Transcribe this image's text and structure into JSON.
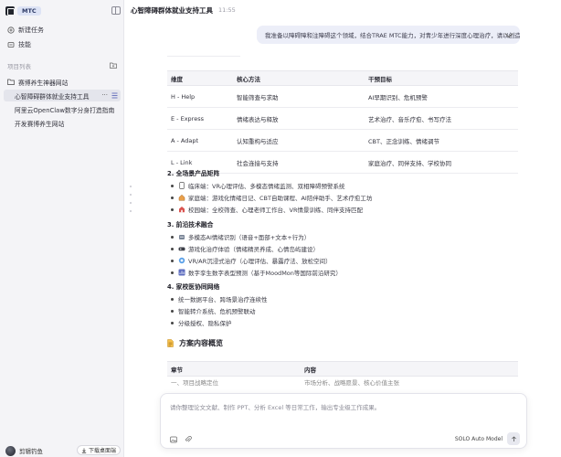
{
  "app": {
    "chip_label": "MTC"
  },
  "sidebar": {
    "nav": [
      {
        "label": "新建任务",
        "icon": "new-task-icon"
      },
      {
        "label": "技能",
        "icon": "skills-icon"
      }
    ],
    "section_label": "项目列表",
    "projects": [
      {
        "label": "赛博养生神器网站",
        "level": 0,
        "active": false
      },
      {
        "label": "心智障碍群体就业支持工具",
        "level": 1,
        "active": true
      },
      {
        "label": "阿里云OpenClaw数字分身打造指南",
        "level": 1,
        "active": false
      },
      {
        "label": "开发赛博养生网站",
        "level": 1,
        "active": false
      }
    ],
    "more_label": "···",
    "user_name": "剪辑钓鱼",
    "download_label": "下载桌面端"
  },
  "header": {
    "title": "心智障碍群体就业支持工具",
    "time": "11:55"
  },
  "user_message": "我准备以障碍障和注障碍这个领域，结合TRAE MTC能力，对青少年进行深度心理治疗，请以创造入",
  "methods_table": {
    "headers": [
      "维度",
      "核心方法",
      "干预目标"
    ],
    "rows": [
      [
        "H - Help",
        "智能筛查与求助",
        "AI早期识别、危机预警"
      ],
      [
        "E - Express",
        "情绪表达与释放",
        "艺术治疗、音乐疗愈、书写疗法"
      ],
      [
        "A - Adapt",
        "认知重构与适应",
        "CBT、正念训练、情绪调节"
      ],
      [
        "L - Link",
        "社会连接与支持",
        "家庭治疗、同伴支持、学校协同"
      ]
    ]
  },
  "section2": {
    "title": "2. 全场景产品矩阵",
    "items": [
      {
        "icon": "phone-icon",
        "text": "临床端：VR心理评估、多模态情绪监测、双相障碍预警系统"
      },
      {
        "icon": "home-icon",
        "text": "家庭端：游戏化情绪日记、CBT自助课程、AI陪伴助手、艺术疗愈工坊"
      },
      {
        "icon": "school-icon",
        "text": "校园端：全校筛查、心理老师工作台、VR情景训练、同伴支持匹配"
      }
    ]
  },
  "section3": {
    "title": "3. 前沿技术融合",
    "items": [
      {
        "icon": "robot-icon",
        "text": "多模态AI情绪识别（语音+面部+文本+行为）"
      },
      {
        "icon": "gamepad-icon",
        "text": "游戏化治疗体验（情绪精灵养成、心情岛屿建设）"
      },
      {
        "icon": "vr-icon",
        "text": "VR/AR沉浸式治疗（心理评估、暴露疗法、放松空间）"
      },
      {
        "icon": "chart-icon",
        "text": "数字孪生数字表型预测（基于MoodMon等国际前沿研究）"
      }
    ]
  },
  "section4": {
    "title": "4. 家校医协同网络",
    "items": [
      "统一数据平台、跨场景治疗连续性",
      "智能转介系统、危机预警联动",
      "分级授权、隐私保护"
    ]
  },
  "overview": {
    "title": "方案内容概览",
    "headers": [
      "章节",
      "内容"
    ],
    "partial_row": [
      "一、项目战略定位",
      "市场分析、战略愿景、核心价值主张"
    ]
  },
  "composer": {
    "placeholder": "请你整理论文文献、制作 PPT、分析 Excel 等日常工作，输出专业级工作成果。",
    "model_label": "SOLO Auto Model"
  }
}
